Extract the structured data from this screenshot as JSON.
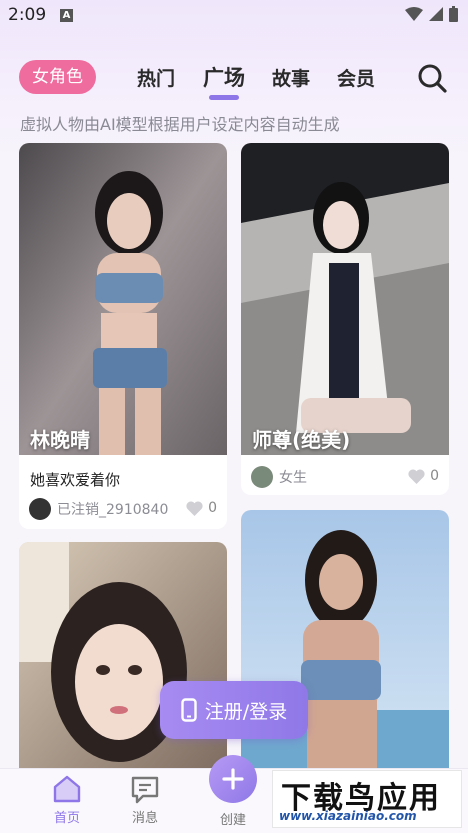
{
  "status_bar": {
    "time": "2:09",
    "notification_glyph": "A",
    "icons": [
      "wifi-icon",
      "signal-icon",
      "battery-icon"
    ]
  },
  "top_nav": {
    "role_pill": "女角色",
    "tabs": [
      {
        "label": "热门",
        "active": false
      },
      {
        "label": "广场",
        "active": true
      },
      {
        "label": "故事",
        "active": false
      },
      {
        "label": "会员",
        "active": false
      }
    ],
    "search_icon": "search-icon"
  },
  "subtitle": "虚拟人物由AI模型根据用户设定内容自动生成",
  "cards": [
    {
      "name": "林晚晴",
      "description": "她喜欢爱着你",
      "author": "已注销_2910840",
      "likes": "0"
    },
    {
      "name": "师尊(绝美)",
      "description": "",
      "author": "女生",
      "likes": "0"
    },
    {
      "name": "",
      "description": "",
      "author": "",
      "likes": ""
    },
    {
      "name": "",
      "description": "",
      "author": "",
      "likes": ""
    }
  ],
  "login_button": {
    "label": "注册/登录",
    "icon": "phone-icon"
  },
  "bottom_nav": {
    "items": [
      {
        "label": "首页",
        "icon": "home-icon",
        "active": true
      },
      {
        "label": "消息",
        "icon": "message-icon",
        "active": false
      },
      {
        "label": "创建",
        "icon": "plus-icon",
        "active": false
      }
    ]
  },
  "watermark": {
    "main": "下载鸟应用",
    "url": "www.xiazainiao.com"
  },
  "colors": {
    "accent": "#8e76e8",
    "pill": "#ef6c9e"
  }
}
